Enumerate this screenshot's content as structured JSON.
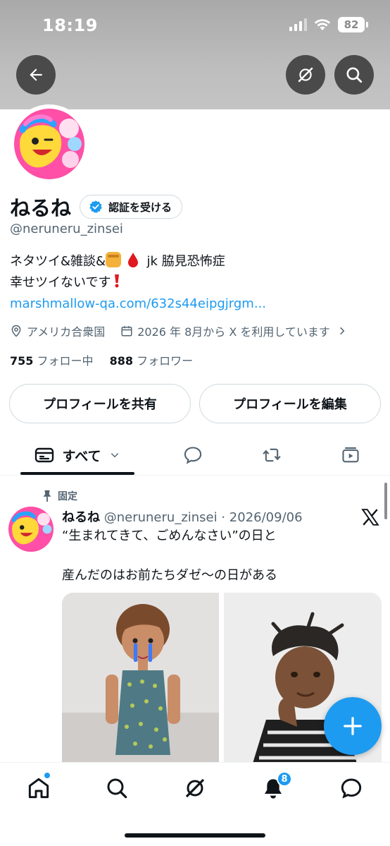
{
  "status_bar": {
    "time": "18:19",
    "battery": "82"
  },
  "profile": {
    "name": "ねるね",
    "verify_label": "認証を受ける",
    "handle": "@neruneru_zinsei",
    "bio_line1_prefix": "ネタツイ&雑談&",
    "bio_line1_suffix": "jk 脇見恐怖症",
    "bio_line2": "幸せツイないです",
    "link": "marshmallow-qa.com/632s44eipgjrgm...",
    "location": "アメリカ合衆国",
    "joined": "2026 年 8月から X を利用しています",
    "following_count": "755",
    "following_label": "フォロー中",
    "followers_count": "888",
    "followers_label": "フォロワー"
  },
  "actions": {
    "share": "プロフィールを共有",
    "edit": "プロフィールを編集"
  },
  "tabs": {
    "all_label": "すべて"
  },
  "post": {
    "pinned_label": "固定",
    "author": "ねるね",
    "meta": "@neruneru_zinsei · 2026/09/06",
    "text1": "“生まれてきて、ごめんなさい”の日と",
    "text2": "産んだのはお前たちダゼ〜の日がある"
  },
  "bottom_nav": {
    "notifications_count": "8"
  },
  "colors": {
    "accent": "#1d9bf0",
    "text": "#0f1419",
    "muted": "#536471"
  }
}
